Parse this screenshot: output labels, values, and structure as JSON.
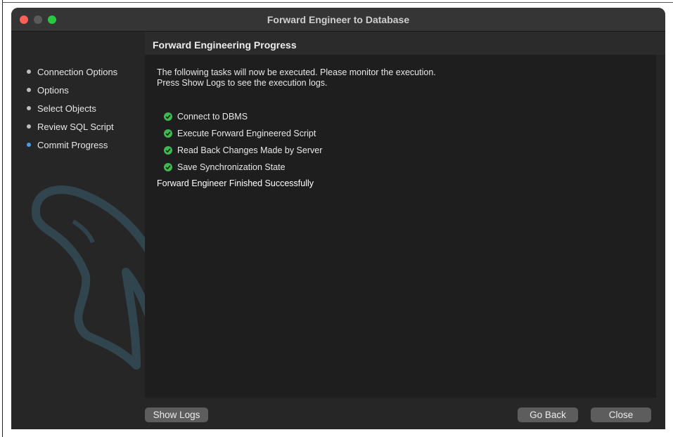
{
  "window": {
    "title": "Forward Engineer to Database"
  },
  "sidebar": {
    "items": [
      {
        "label": "Connection Options",
        "active": false
      },
      {
        "label": "Options",
        "active": false
      },
      {
        "label": "Select Objects",
        "active": false
      },
      {
        "label": "Review SQL Script",
        "active": false
      },
      {
        "label": "Commit Progress",
        "active": true
      }
    ]
  },
  "main": {
    "title": "Forward Engineering Progress",
    "intro_line1": "The following tasks will now be executed. Please monitor the execution.",
    "intro_line2": "Press Show Logs to see the execution logs.",
    "tasks": [
      {
        "label": "Connect to DBMS",
        "status": "done"
      },
      {
        "label": "Execute Forward Engineered Script",
        "status": "done"
      },
      {
        "label": "Read Back Changes Made by Server",
        "status": "done"
      },
      {
        "label": "Save Synchronization State",
        "status": "done"
      }
    ],
    "status_message": "Forward Engineer Finished Successfully"
  },
  "footer": {
    "show_logs_label": "Show Logs",
    "go_back_label": "Go Back",
    "close_label": "Close"
  },
  "icons": {
    "close": "close-traffic-light",
    "minimize": "minimize-traffic-light",
    "maximize": "maximize-traffic-light",
    "task_status": "check-circle-icon",
    "watermark": "dolphin-logo"
  },
  "colors": {
    "success": "#3fb950",
    "active_bullet": "#4a9be8",
    "close_light": "#ff5f57",
    "max_light": "#28c840"
  }
}
